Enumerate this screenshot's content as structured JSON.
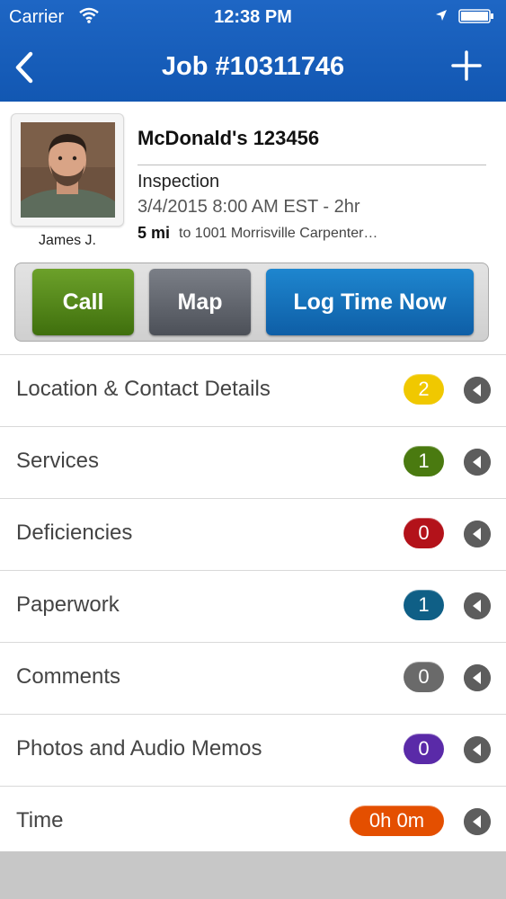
{
  "status_bar": {
    "carrier": "Carrier",
    "time": "12:38 PM"
  },
  "nav": {
    "title": "Job #10311746",
    "back_icon": "chevron-left-icon",
    "add_icon": "plus-icon"
  },
  "job": {
    "technician": "James J.",
    "name": "McDonald's 123456",
    "type": "Inspection",
    "datetime": "3/4/2015 8:00 AM EST - 2hr",
    "distance": "5 mi",
    "address": "to 1001 Morrisville Carpenter…"
  },
  "actions": {
    "call": "Call",
    "map": "Map",
    "log_time": "Log Time Now"
  },
  "sections": [
    {
      "label": "Location & Contact Details",
      "count": "2",
      "color": "#f0c800"
    },
    {
      "label": "Services",
      "count": "1",
      "color": "#4a7a10"
    },
    {
      "label": "Deficiencies",
      "count": "0",
      "color": "#b3121a"
    },
    {
      "label": "Paperwork",
      "count": "1",
      "color": "#0f5f86"
    },
    {
      "label": "Comments",
      "count": "0",
      "color": "#6a6a6a"
    },
    {
      "label": "Photos and Audio Memos",
      "count": "0",
      "color": "#5a2aa8"
    },
    {
      "label": "Time",
      "count": "0h 0m",
      "color": "#e44f00"
    }
  ],
  "colors": {
    "nav_bar": "#1a5fbb",
    "call": "#4f8418",
    "map": "#5d6169",
    "log_time": "#1470b9"
  }
}
